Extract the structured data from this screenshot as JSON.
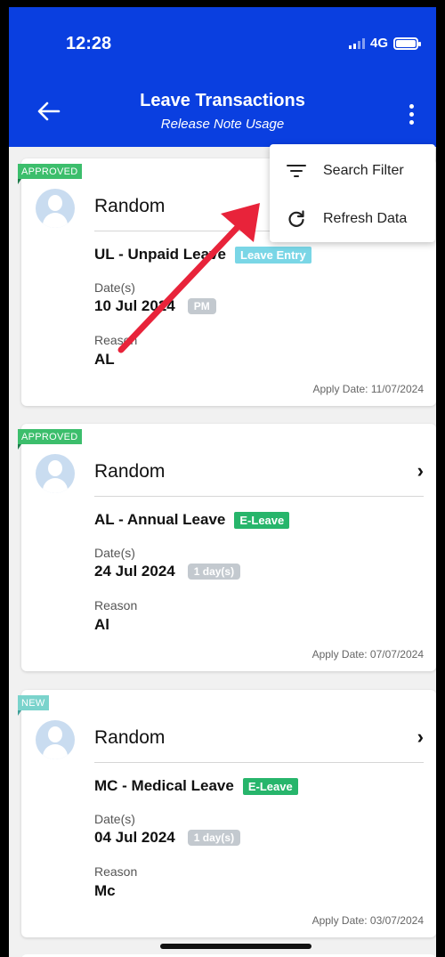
{
  "status_bar": {
    "time": "12:28",
    "network": "4G"
  },
  "header": {
    "title": "Leave Transactions",
    "subtitle": "Release Note Usage"
  },
  "menu": {
    "items": [
      {
        "label": "Search Filter",
        "icon": "filter-icon"
      },
      {
        "label": "Refresh Data",
        "icon": "refresh-icon"
      }
    ]
  },
  "cards": [
    {
      "status": "APPROVED",
      "name": "Random",
      "leave_type": "UL - Unpaid Leave",
      "tag": "Leave Entry",
      "dates_label": "Date(s)",
      "date": "10 Jul 2024",
      "duration": "PM",
      "reason_label": "Reason",
      "reason": "AL",
      "apply_date": "Apply Date: 11/07/2024"
    },
    {
      "status": "APPROVED",
      "name": "Random",
      "leave_type": "AL - Annual Leave",
      "tag": "E-Leave",
      "dates_label": "Date(s)",
      "date": "24 Jul 2024",
      "duration": "1 day(s)",
      "reason_label": "Reason",
      "reason": "Al",
      "apply_date": "Apply Date: 07/07/2024"
    },
    {
      "status": "NEW",
      "name": "Random",
      "leave_type": "MC - Medical Leave",
      "tag": "E-Leave",
      "dates_label": "Date(s)",
      "date": "04 Jul 2024",
      "duration": "1 day(s)",
      "reason_label": "Reason",
      "reason": "Mc",
      "apply_date": "Apply Date: 03/07/2024"
    }
  ],
  "colors": {
    "header_bg": "#0a3fe0",
    "approved": "#3cbe6c",
    "new": "#7ad3cc",
    "e_leave": "#27b56b",
    "leave_entry": "#7ad6e6",
    "annotation_arrow": "#e8233a"
  }
}
